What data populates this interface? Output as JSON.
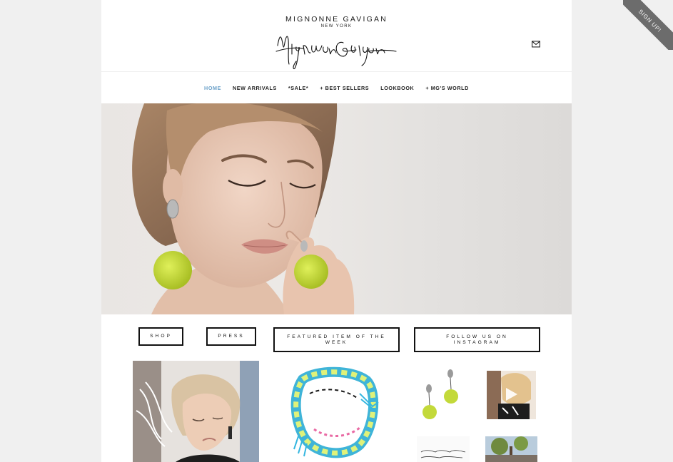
{
  "header": {
    "brand_name": "MIGNONNE GAVIGAN",
    "brand_location": "NEW YORK",
    "mail_icon": "mail-icon"
  },
  "nav": {
    "items": [
      "HOME",
      "NEW ARRIVALS",
      "*SALE*",
      "+ BEST SELLERS",
      "LOOKBOOK",
      "+ MG'S WORLD"
    ],
    "active": "HOME",
    "active_color": "#6ba1c9"
  },
  "ctas": {
    "shop": "SHOP",
    "press": "PRESS",
    "featured": "FEATURED ITEM OF THE WEEK",
    "instagram": "FOLLOW US ON INSTAGRAM"
  },
  "ribbon": {
    "label": "SIGN UP!"
  },
  "colors": {
    "accent": "#6ba1c9",
    "pom": "#c8dc3a",
    "ribbon": "#6c6c6c"
  }
}
